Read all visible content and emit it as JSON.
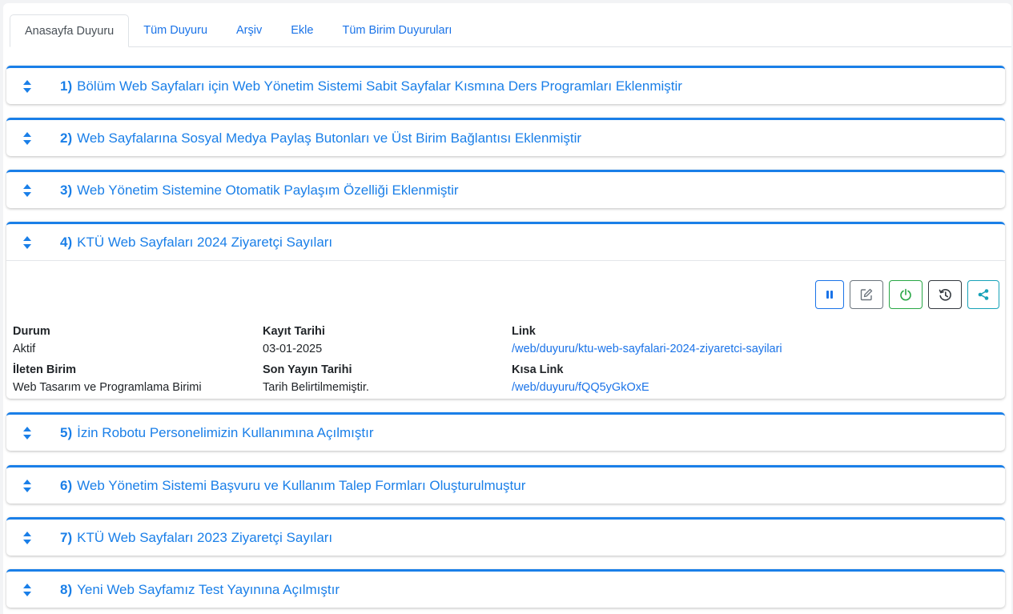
{
  "tabs": [
    {
      "label": "Anasayfa Duyuru",
      "active": true
    },
    {
      "label": "Tüm Duyuru",
      "active": false
    },
    {
      "label": "Arşiv",
      "active": false
    },
    {
      "label": "Ekle",
      "active": false
    },
    {
      "label": "Tüm Birim Duyuruları",
      "active": false
    }
  ],
  "announcements": [
    {
      "num": "1)",
      "title": "Bölüm Web Sayfaları için Web Yönetim Sistemi Sabit Sayfalar Kısmına Ders Programları Eklenmiştir"
    },
    {
      "num": "2)",
      "title": "Web Sayfalarına Sosyal Medya Paylaş Butonları ve Üst Birim Bağlantısı Eklenmiştir"
    },
    {
      "num": "3)",
      "title": "Web Yönetim Sistemine Otomatik Paylaşım Özelliği Eklenmiştir"
    },
    {
      "num": "4)",
      "title": "KTÜ Web Sayfaları 2024 Ziyaretçi Sayıları"
    },
    {
      "num": "5)",
      "title": "İzin Robotu Personelimizin Kullanımına Açılmıştır"
    },
    {
      "num": "6)",
      "title": "Web Yönetim Sistemi Başvuru ve Kullanım Talep Formları Oluşturulmuştur"
    },
    {
      "num": "7)",
      "title": "KTÜ Web Sayfaları 2023 Ziyaretçi Sayıları"
    },
    {
      "num": "8)",
      "title": "Yeni Web Sayfamız Test Yayınına Açılmıştır"
    }
  ],
  "detail": {
    "durum_label": "Durum",
    "durum_value": "Aktif",
    "kayit_label": "Kayıt Tarihi",
    "kayit_value": "03-01-2025",
    "link_label": "Link",
    "link_value": "/web/duyuru/ktu-web-sayfalari-2024-ziyaretci-sayilari",
    "birim_label": "İleten Birim",
    "birim_value": "Web Tasarım ve Programlama Birimi",
    "yayin_label": "Son Yayın Tarihi",
    "yayin_value": "Tarih Belirtilmemiştir.",
    "kisa_label": "Kısa Link",
    "kisa_value": "/web/duyuru/fQQ5yGkOxE"
  },
  "icons": [
    "sort-icon",
    "pause-icon",
    "edit-icon",
    "power-icon",
    "history-icon",
    "share-icon"
  ],
  "colors": {
    "accent": "#1a7fe8",
    "green": "#28a745",
    "teal": "#17a2b8"
  }
}
